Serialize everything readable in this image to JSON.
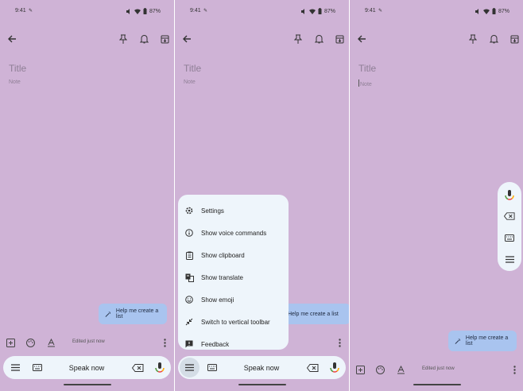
{
  "status": {
    "time": "9:41",
    "battery": "87%"
  },
  "note": {
    "title_placeholder": "Title",
    "note_placeholder": "Note"
  },
  "help": {
    "label": "Help me create a list"
  },
  "editbar": {
    "edited": "Edited just now"
  },
  "voicebar": {
    "speak_label": "Speak now"
  },
  "menu": {
    "items": [
      {
        "label": "Settings",
        "icon": "gear-icon"
      },
      {
        "label": "Show voice commands",
        "icon": "info-icon"
      },
      {
        "label": "Show clipboard",
        "icon": "clipboard-icon"
      },
      {
        "label": "Show translate",
        "icon": "translate-icon"
      },
      {
        "label": "Show emoji",
        "icon": "emoji-icon"
      },
      {
        "label": "Switch to vertical toolbar",
        "icon": "collapse-icon"
      },
      {
        "label": "Feedback",
        "icon": "feedback-icon"
      }
    ]
  },
  "colors": {
    "background": "#cfb3d6",
    "help_pill": "#a9c4ef",
    "toolbar": "#eef5fb"
  }
}
